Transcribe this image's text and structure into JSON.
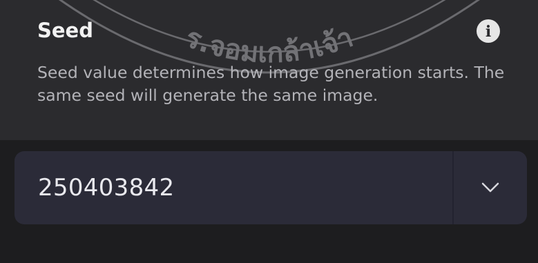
{
  "seed_setting": {
    "title": "Seed",
    "info_icon_glyph": "i",
    "description": "Seed value determines how image generation starts. The same seed will generate the same image.",
    "value": "250403842",
    "dropdown_icon": "chevron-down-icon"
  },
  "watermark": {
    "text": "ร.จอมเกล้าเจ้า"
  },
  "colors": {
    "panel_background": "#2b2b2e",
    "page_background": "#1d1d1f",
    "field_background": "#2b2b38",
    "title_text": "#f2f2f2",
    "description_text": "#b3b3b8"
  }
}
